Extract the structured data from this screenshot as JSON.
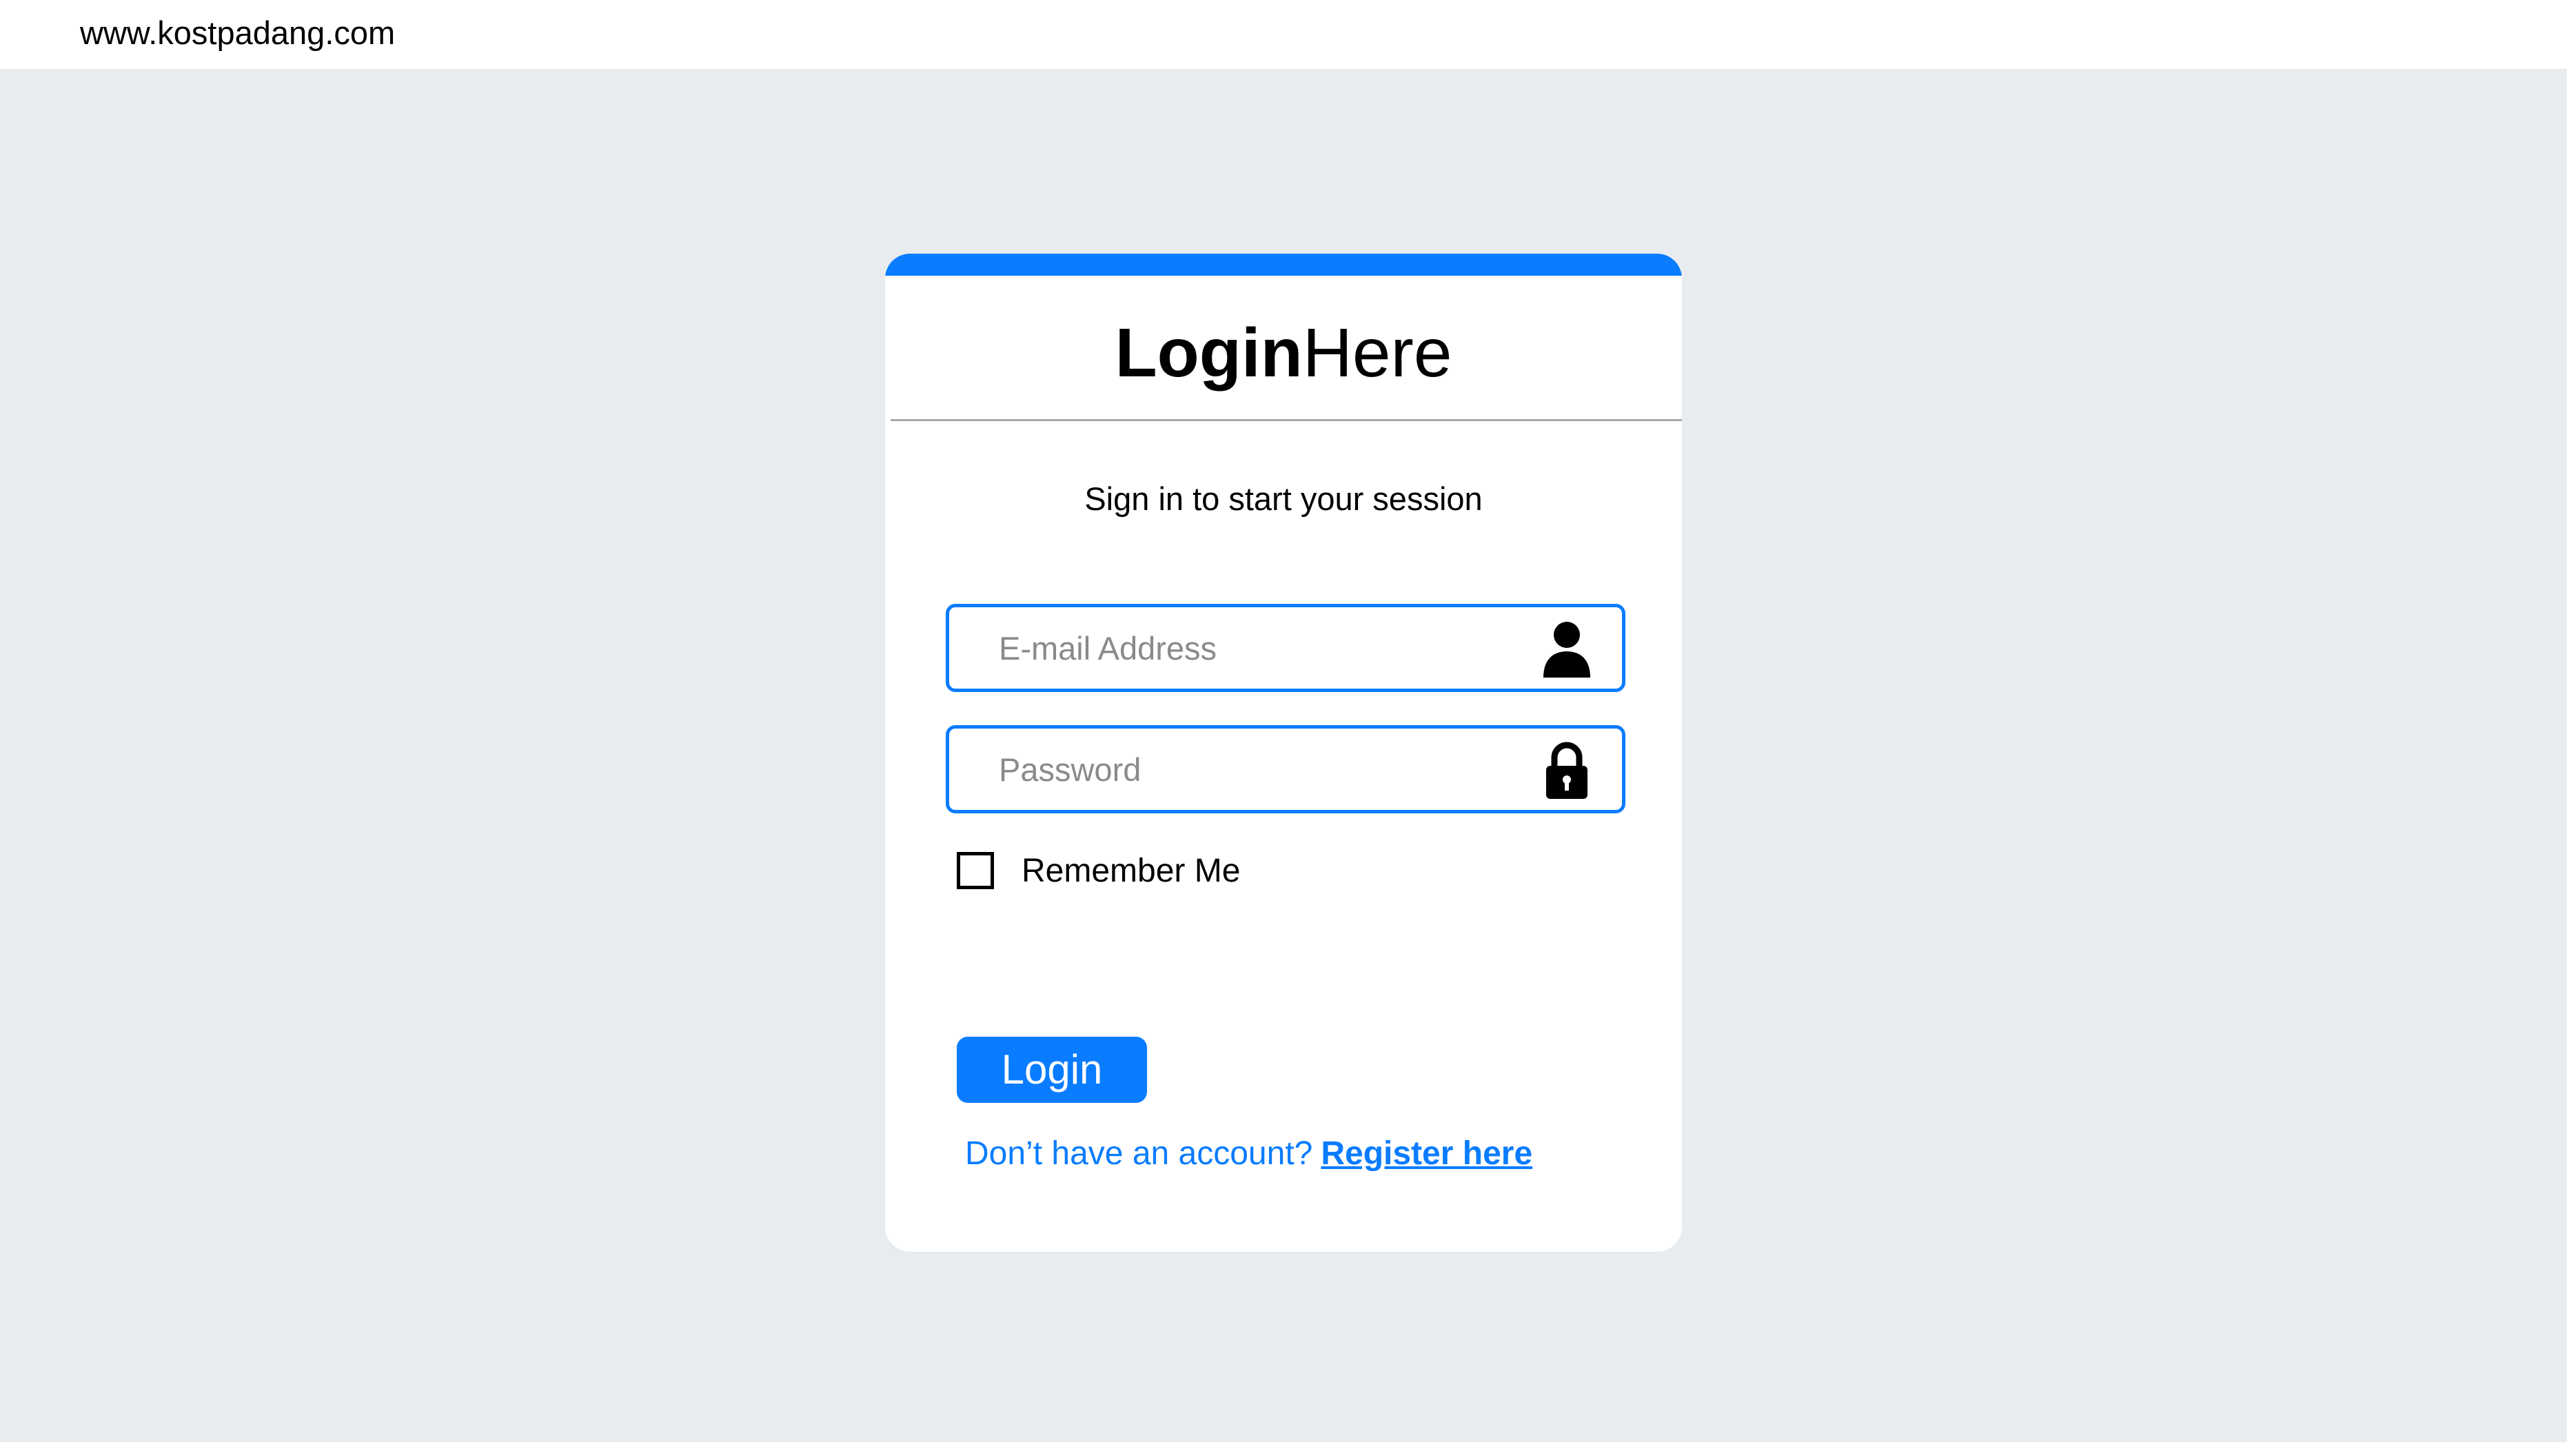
{
  "browser": {
    "url": "www.kostpadang.com"
  },
  "login_card": {
    "title_bold": "Login",
    "title_regular": "Here",
    "subtitle": "Sign in to start your session",
    "email": {
      "placeholder": "E-mail Address",
      "value": "",
      "icon": "user-icon"
    },
    "password": {
      "placeholder": "Password",
      "value": "",
      "icon": "lock-icon"
    },
    "remember_me": {
      "label": "Remember Me",
      "checked": false
    },
    "login_button": "Login",
    "register_prompt": "Don’t have an account?",
    "register_link": "Register here"
  },
  "colors": {
    "accent": "#0a7cff",
    "background": "#e8ecef",
    "card": "#ffffff"
  }
}
